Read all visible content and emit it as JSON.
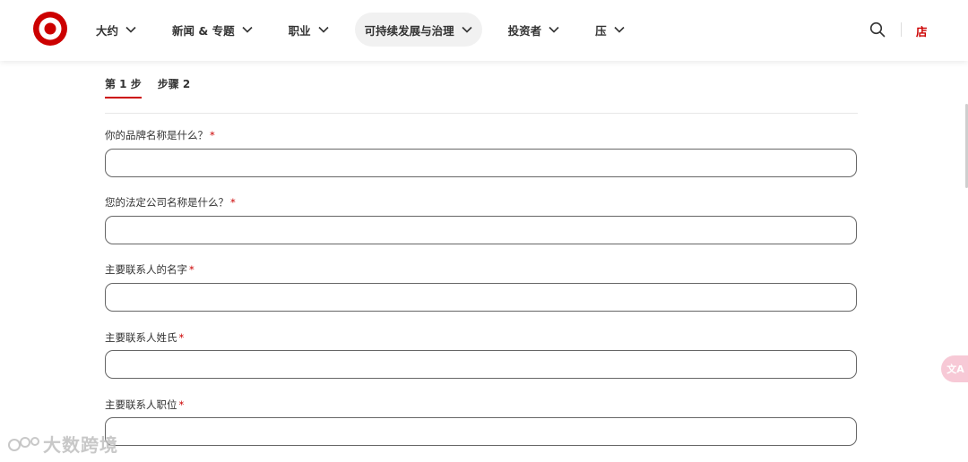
{
  "brand": {
    "logo": "target-bullseye-logo",
    "accent_color": "#cc0000"
  },
  "nav": {
    "items": [
      {
        "label": "大约",
        "icon": "chevron-down-icon"
      },
      {
        "label": "新闻 & 专题",
        "icon": "chevron-down-icon"
      },
      {
        "label": "职业",
        "icon": "chevron-down-icon"
      },
      {
        "label": "可持续发展与治理",
        "icon": "chevron-down-icon",
        "active": true
      },
      {
        "label": "投资者",
        "icon": "chevron-down-icon"
      },
      {
        "label": "压",
        "icon": "chevron-down-icon"
      }
    ],
    "search_icon": "search-icon",
    "store_label": "店"
  },
  "steps": [
    {
      "label": "第 1 步",
      "active": true
    },
    {
      "label": "步骤 2",
      "active": false
    }
  ],
  "form": {
    "fields": [
      {
        "label": "你的品牌名称是什么？",
        "required": "*",
        "value": ""
      },
      {
        "label": "您的法定公司名称是什么？",
        "required": "*",
        "value": ""
      },
      {
        "label": "主要联系人的名字",
        "required": "*",
        "value": ""
      },
      {
        "label": "主要联系人姓氏",
        "required": "*",
        "value": ""
      },
      {
        "label": "主要联系人职位",
        "required": "*",
        "value": ""
      }
    ]
  },
  "translate_button": {
    "label": "文A",
    "color": "#f7c9d6"
  },
  "watermark": {
    "text": "大数跨境"
  }
}
